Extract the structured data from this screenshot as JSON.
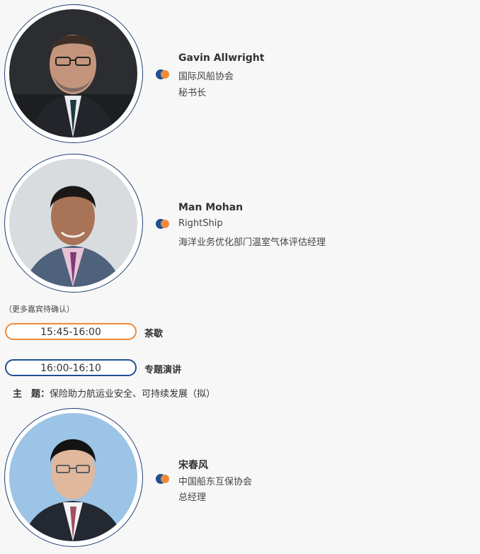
{
  "speakers": [
    {
      "name": "Gavin Allwright",
      "organization": "国际风船协会",
      "title": "秘书长"
    },
    {
      "name": "Man Mohan",
      "organization": "RightShip",
      "title": "海洋业务优化部门温室气体评估经理"
    },
    {
      "name": "宋春风",
      "organization": "中国船东互保协会",
      "title": "总经理"
    }
  ],
  "note": "（更多嘉宾待确认）",
  "sessions": [
    {
      "time": "15:45-16:00",
      "label": "茶歇"
    },
    {
      "time": "16:00-16:10",
      "label": "专题演讲"
    }
  ],
  "topic": {
    "key": "主　题：",
    "value": "保险助力航运业安全、可持续发展（拟）"
  },
  "colors": {
    "accent_orange": "#ee8a3a",
    "accent_blue": "#1f4f96",
    "ring_navy": "#1f3f72"
  }
}
